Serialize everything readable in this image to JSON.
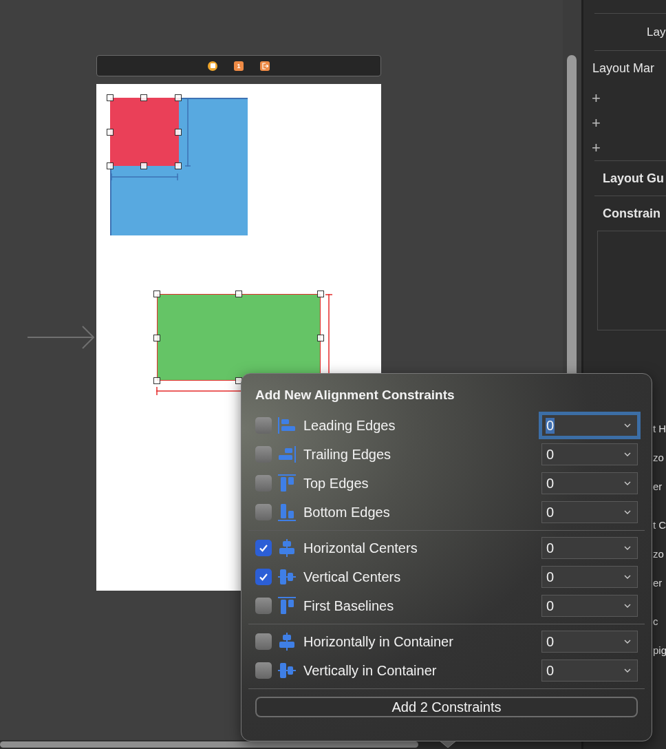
{
  "scene_dock": {
    "badge": "1"
  },
  "inspector": {
    "rows": [
      {
        "kind": "label",
        "text": "Lay"
      },
      {
        "kind": "heading",
        "text": "Layout Mar"
      },
      {
        "kind": "add",
        "text": "+"
      },
      {
        "kind": "add",
        "text": "+"
      },
      {
        "kind": "add",
        "text": "+"
      },
      {
        "kind": "section",
        "text": "Layout Gu"
      },
      {
        "kind": "section",
        "text": "Constrain"
      }
    ],
    "peeking": [
      [
        "t H",
        "zo",
        "er"
      ],
      [
        "t C",
        "zo",
        "er"
      ],
      [
        "c",
        "pig"
      ]
    ]
  },
  "popover": {
    "title": "Add New Alignment Constraints",
    "groups": [
      [
        {
          "label": "Leading Edges",
          "checked": false,
          "value": "0",
          "focused": true
        },
        {
          "label": "Trailing Edges",
          "checked": false,
          "value": "0",
          "focused": false
        },
        {
          "label": "Top Edges",
          "checked": false,
          "value": "0",
          "focused": false
        },
        {
          "label": "Bottom Edges",
          "checked": false,
          "value": "0",
          "focused": false
        }
      ],
      [
        {
          "label": "Horizontal Centers",
          "checked": true,
          "value": "0",
          "focused": false
        },
        {
          "label": "Vertical Centers",
          "checked": true,
          "value": "0",
          "focused": false
        },
        {
          "label": "First Baselines",
          "checked": false,
          "value": "0",
          "focused": false
        }
      ],
      [
        {
          "label": "Horizontally in Container",
          "checked": false,
          "value": "0",
          "focused": false
        },
        {
          "label": "Vertically in Container",
          "checked": false,
          "value": "0",
          "focused": false
        }
      ]
    ],
    "button": "Add 2 Constraints"
  }
}
